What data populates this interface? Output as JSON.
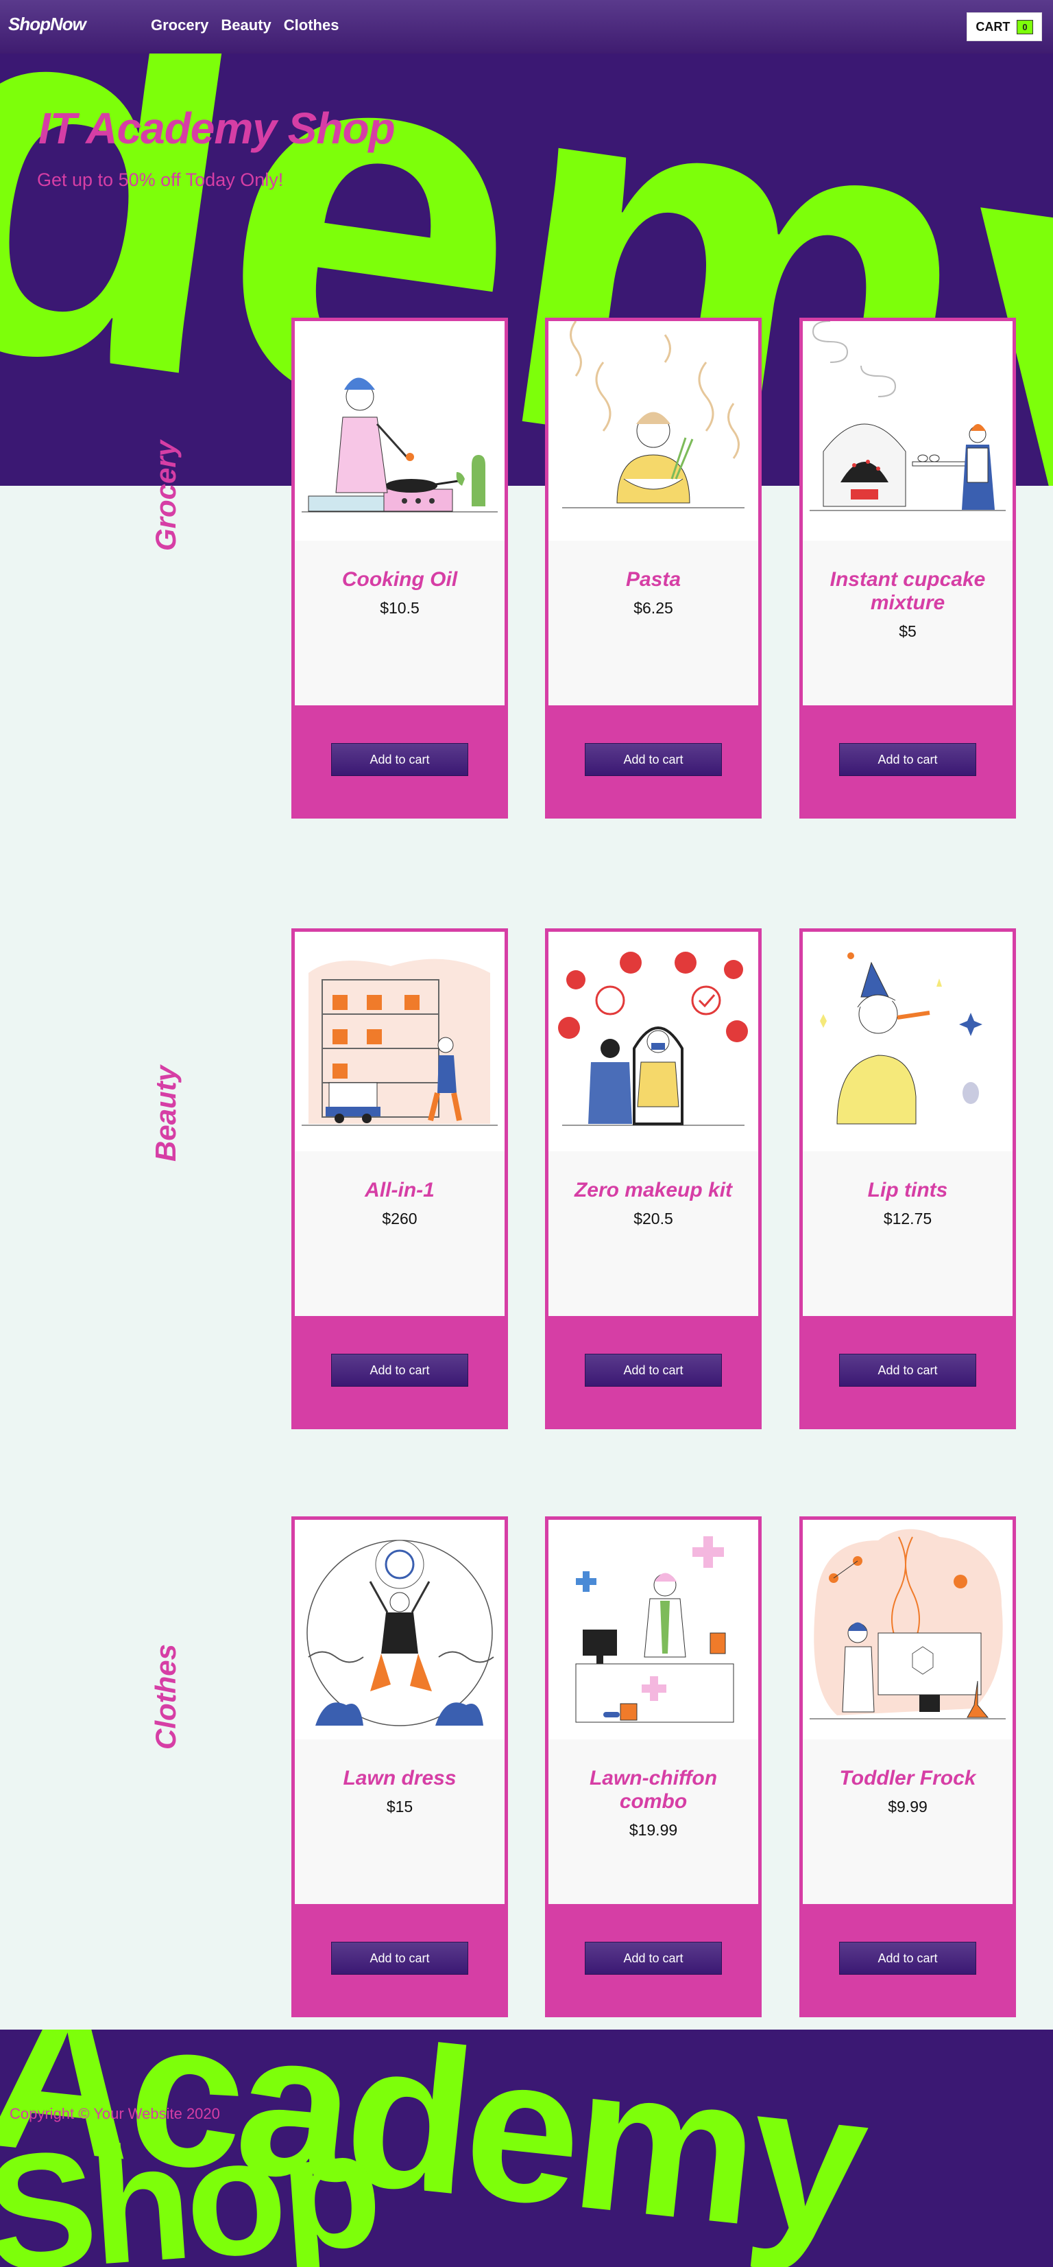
{
  "nav": {
    "brand": "ShopNow",
    "links": [
      "Grocery",
      "Beauty",
      "Clothes"
    ],
    "cart_label": "CART",
    "cart_count": "0"
  },
  "hero": {
    "title": "IT Academy Shop",
    "subtitle": "Get up to 50% off Today Only!",
    "decoration": "demy"
  },
  "categories": [
    {
      "name": "Grocery",
      "products": [
        {
          "name": "Cooking Oil",
          "price": "$10.5",
          "button": "Add to cart"
        },
        {
          "name": "Pasta",
          "price": "$6.25",
          "button": "Add to cart"
        },
        {
          "name": "Instant cupcake mixture",
          "price": "$5",
          "button": "Add to cart"
        }
      ]
    },
    {
      "name": "Beauty",
      "products": [
        {
          "name": "All-in-1",
          "price": "$260",
          "button": "Add to cart"
        },
        {
          "name": "Zero makeup kit",
          "price": "$20.5",
          "button": "Add to cart"
        },
        {
          "name": "Lip tints",
          "price": "$12.75",
          "button": "Add to cart"
        }
      ]
    },
    {
      "name": "Clothes",
      "products": [
        {
          "name": "Lawn dress",
          "price": "$15",
          "button": "Add to cart"
        },
        {
          "name": "Lawn-chiffon combo",
          "price": "$19.99",
          "button": "Add to cart"
        },
        {
          "name": "Toddler Frock",
          "price": "$9.99",
          "button": "Add to cart"
        }
      ]
    }
  ],
  "footer": {
    "decoration_top": "Academy",
    "decoration_bottom": "Shop",
    "copyright": "Copyright © Your Website 2020"
  },
  "colors": {
    "purple": "#3b1873",
    "lime": "#7dff0a",
    "pink": "#d63ea5",
    "background": "#edf6f3"
  }
}
